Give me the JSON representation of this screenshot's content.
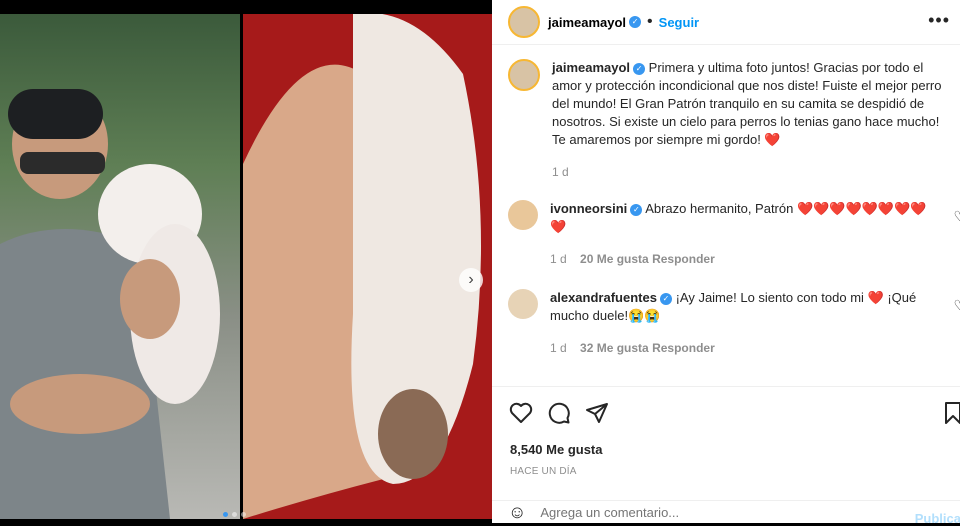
{
  "header": {
    "username": "jaimeamayol",
    "separator": "•",
    "follow_label": "Seguir",
    "more_icon": "more-horizontal-icon"
  },
  "caption": {
    "username": "jaimeamayol",
    "text": "Primera y ultima foto juntos! Gracias por todo el amor y protección incondicional que nos diste! Fuiste el mejor perro del mundo! El Gran Patrón tranquilo en su camita se despidió de nosotros. Si existe un cielo para perros lo tenias gano hace mucho! Te amaremos por siempre mi gordo! ❤️",
    "time": "1 d"
  },
  "comments": [
    {
      "username": "ivonneorsini",
      "text": "Abrazo hermanito, Patrón ❤️❤️❤️❤️❤️❤️❤️❤️❤️",
      "time": "1 d",
      "likes": "20 Me gusta",
      "reply": "Responder"
    },
    {
      "username": "alexandrafuentes",
      "text": "¡Ay Jaime! Lo siento con todo mi ❤️ ¡Qué mucho duele!😭😭",
      "time": "1 d",
      "likes": "32 Me gusta",
      "reply": "Responder"
    }
  ],
  "actions": {
    "like_icon": "heart-icon",
    "comment_icon": "comment-icon",
    "share_icon": "share-icon",
    "save_icon": "bookmark-icon"
  },
  "likes_text": "8,540 Me gusta",
  "posted_time": "HACE UN DÍA",
  "add_comment": {
    "emoji_icon": "emoji-icon",
    "placeholder": "Agrega un comentario...",
    "publish_label": "Publicar"
  },
  "carousel": {
    "next_icon": "chevron-right-icon",
    "slides": 3,
    "active": 1
  }
}
